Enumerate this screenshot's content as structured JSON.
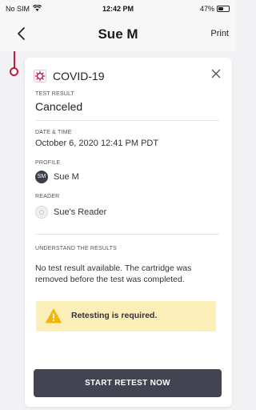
{
  "status_bar": {
    "carrier": "No SIM",
    "time": "12:42 PM",
    "battery": "47%",
    "battery_level": 0.47
  },
  "nav": {
    "back_icon": "chevron-left-icon",
    "title": "Sue M",
    "print_label": "Print"
  },
  "card": {
    "test_icon": "covid-virus-icon",
    "test_name": "COVID-19",
    "close_icon": "close-icon",
    "test_result": {
      "label": "TEST RESULT",
      "value": "Canceled"
    },
    "date_time": {
      "label": "DATE & TIME",
      "value": "October 6, 2020  12:41 PM PDT"
    },
    "profile": {
      "label": "PROFILE",
      "initials": "SM",
      "name": "Sue M"
    },
    "reader": {
      "label": "READER",
      "name": "Sue's Reader"
    },
    "understand": {
      "label": "UNDERSTAND THE RESULTS",
      "text": "No test result available. The cartridge was removed before the test was completed."
    },
    "warning": {
      "icon": "warning-triangle-icon",
      "text": "Retesting is required."
    },
    "retest_button": "START RETEST NOW"
  },
  "colors": {
    "accent": "#c8173a",
    "button": "#424551",
    "warning_bg": "#fbeeb8",
    "warning_icon": "#f2b705"
  }
}
